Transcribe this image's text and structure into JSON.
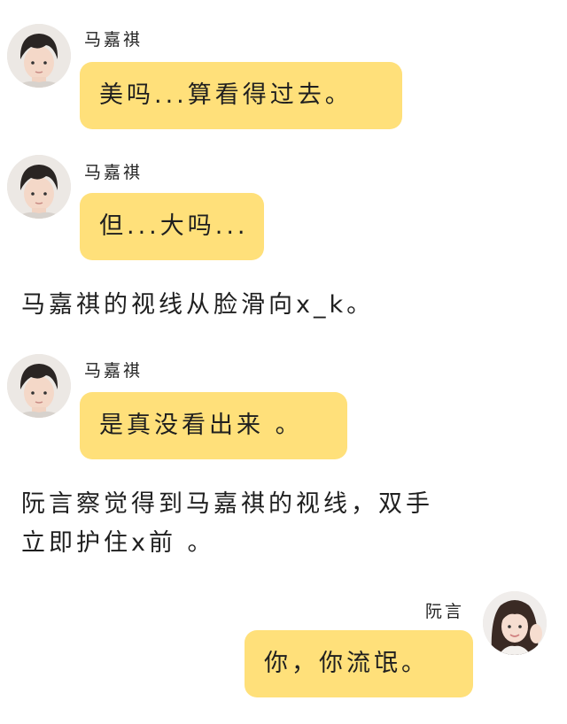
{
  "messages": [
    {
      "sender": "马嘉祺",
      "text": "美吗...算看得过去。"
    },
    {
      "sender": "马嘉祺",
      "text": "但...大吗..."
    },
    {
      "sender": "马嘉祺",
      "text": "是真没看出来 。"
    },
    {
      "sender": "阮言",
      "text": "你，你流氓。"
    }
  ],
  "narration": [
    {
      "lines": [
        "马嘉祺的视线从脸滑向x_k。"
      ]
    },
    {
      "lines": [
        "阮言察觉得到马嘉祺的视线，双手",
        "立即护住x前 。"
      ]
    }
  ],
  "colors": {
    "bubble": "#ffe07a",
    "background": "#ffffff"
  },
  "icons": {
    "avatar_left": "boy-avatar-icon",
    "avatar_right": "girl-avatar-icon"
  }
}
